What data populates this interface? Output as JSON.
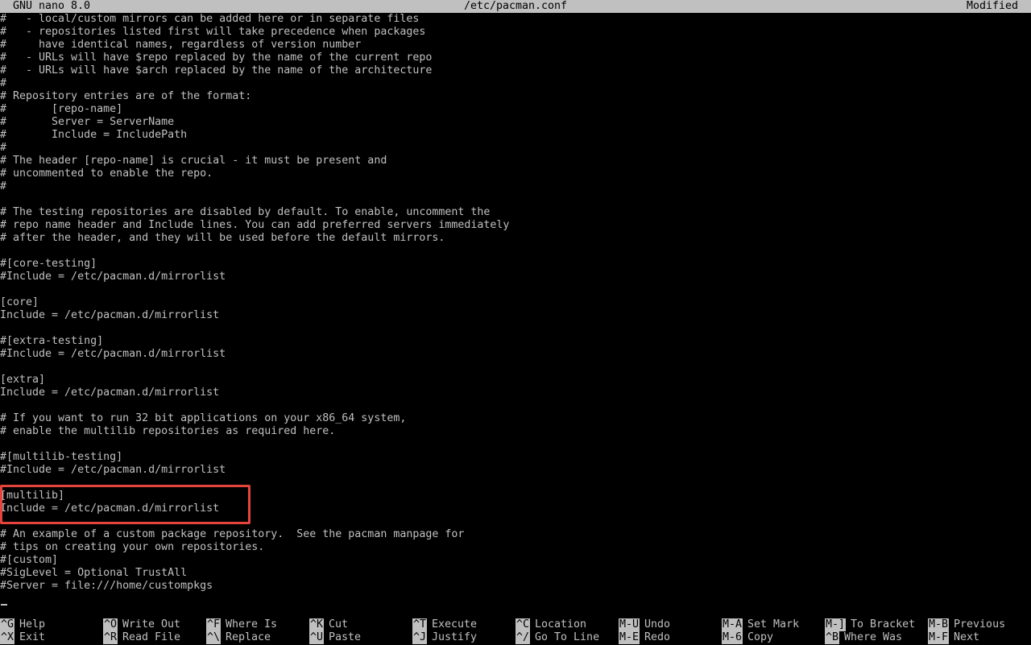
{
  "titlebar": {
    "app": "GNU nano 8.0",
    "filename": "/etc/pacman.conf",
    "status": "Modified"
  },
  "editor": {
    "lines": [
      "#   - local/custom mirrors can be added here or in separate files",
      "#   - repositories listed first will take precedence when packages",
      "#     have identical names, regardless of version number",
      "#   - URLs will have $repo replaced by the name of the current repo",
      "#   - URLs will have $arch replaced by the name of the architecture",
      "#",
      "# Repository entries are of the format:",
      "#       [repo-name]",
      "#       Server = ServerName",
      "#       Include = IncludePath",
      "#",
      "# The header [repo-name] is crucial - it must be present and",
      "# uncommented to enable the repo.",
      "#",
      "",
      "# The testing repositories are disabled by default. To enable, uncomment the",
      "# repo name header and Include lines. You can add preferred servers immediately",
      "# after the header, and they will be used before the default mirrors.",
      "",
      "#[core-testing]",
      "#Include = /etc/pacman.d/mirrorlist",
      "",
      "[core]",
      "Include = /etc/pacman.d/mirrorlist",
      "",
      "#[extra-testing]",
      "#Include = /etc/pacman.d/mirrorlist",
      "",
      "[extra]",
      "Include = /etc/pacman.d/mirrorlist",
      "",
      "# If you want to run 32 bit applications on your x86_64 system,",
      "# enable the multilib repositories as required here.",
      "",
      "#[multilib-testing]",
      "#Include = /etc/pacman.d/mirrorlist",
      "",
      "[multilib]",
      "Include = /etc/pacman.d/mirrorlist",
      "",
      "# An example of a custom package repository.  See the pacman manpage for",
      "# tips on creating your own repositories.",
      "#[custom]",
      "#SigLevel = Optional TrustAll",
      "#Server = file:///home/custompkgs",
      ""
    ]
  },
  "shortcuts": [
    {
      "key": "^G",
      "label": "Help"
    },
    {
      "key": "^X",
      "label": "Exit"
    },
    {
      "key": "^O",
      "label": "Write Out"
    },
    {
      "key": "^R",
      "label": "Read File"
    },
    {
      "key": "^F",
      "label": "Where Is"
    },
    {
      "key": "^\\",
      "label": "Replace"
    },
    {
      "key": "^K",
      "label": "Cut"
    },
    {
      "key": "^U",
      "label": "Paste"
    },
    {
      "key": "^T",
      "label": "Execute"
    },
    {
      "key": "^J",
      "label": "Justify"
    },
    {
      "key": "^C",
      "label": "Location"
    },
    {
      "key": "^/",
      "label": "Go To Line"
    },
    {
      "key": "M-U",
      "label": "Undo"
    },
    {
      "key": "M-E",
      "label": "Redo"
    },
    {
      "key": "M-A",
      "label": "Set Mark"
    },
    {
      "key": "M-6",
      "label": "Copy"
    },
    {
      "key": "M-]",
      "label": "To Bracket"
    },
    {
      "key": "^B",
      "label": "Where Was"
    },
    {
      "key": "M-B",
      "label": "Previous"
    },
    {
      "key": "M-F",
      "label": "Next"
    }
  ],
  "colors": {
    "terminal_bg": "#000000",
    "terminal_fg": "#c0c0c0",
    "highlight_border": "#e5443c"
  }
}
